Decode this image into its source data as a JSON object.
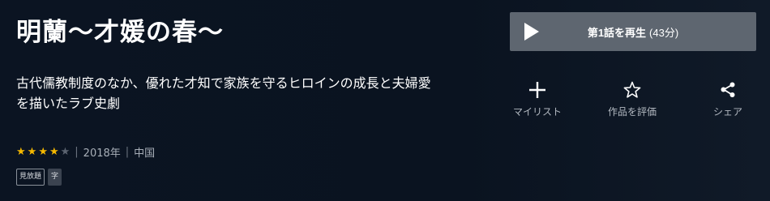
{
  "title": "明蘭～才媛の春～",
  "description": "古代儒教制度のなか、優れた才知で家族を守るヒロインの成長と夫婦愛を描いたラブ史劇",
  "rating": 4,
  "rating_max": 5,
  "meta": {
    "separator": "|",
    "year": "2018年",
    "country": "中国"
  },
  "badges": [
    "見放題",
    "字"
  ],
  "play_button": {
    "label": "第1話を再生",
    "duration": "(43分)"
  },
  "actions": {
    "mylist": "マイリスト",
    "rate": "作品を評価",
    "share": "シェア"
  },
  "icons": [
    "play-icon",
    "plus-icon",
    "star-icon",
    "share-icon"
  ],
  "colors": {
    "background": "#0a1320",
    "play_button": "#5e6670",
    "star_on": "#f5b800",
    "star_off": "#5b6370"
  }
}
